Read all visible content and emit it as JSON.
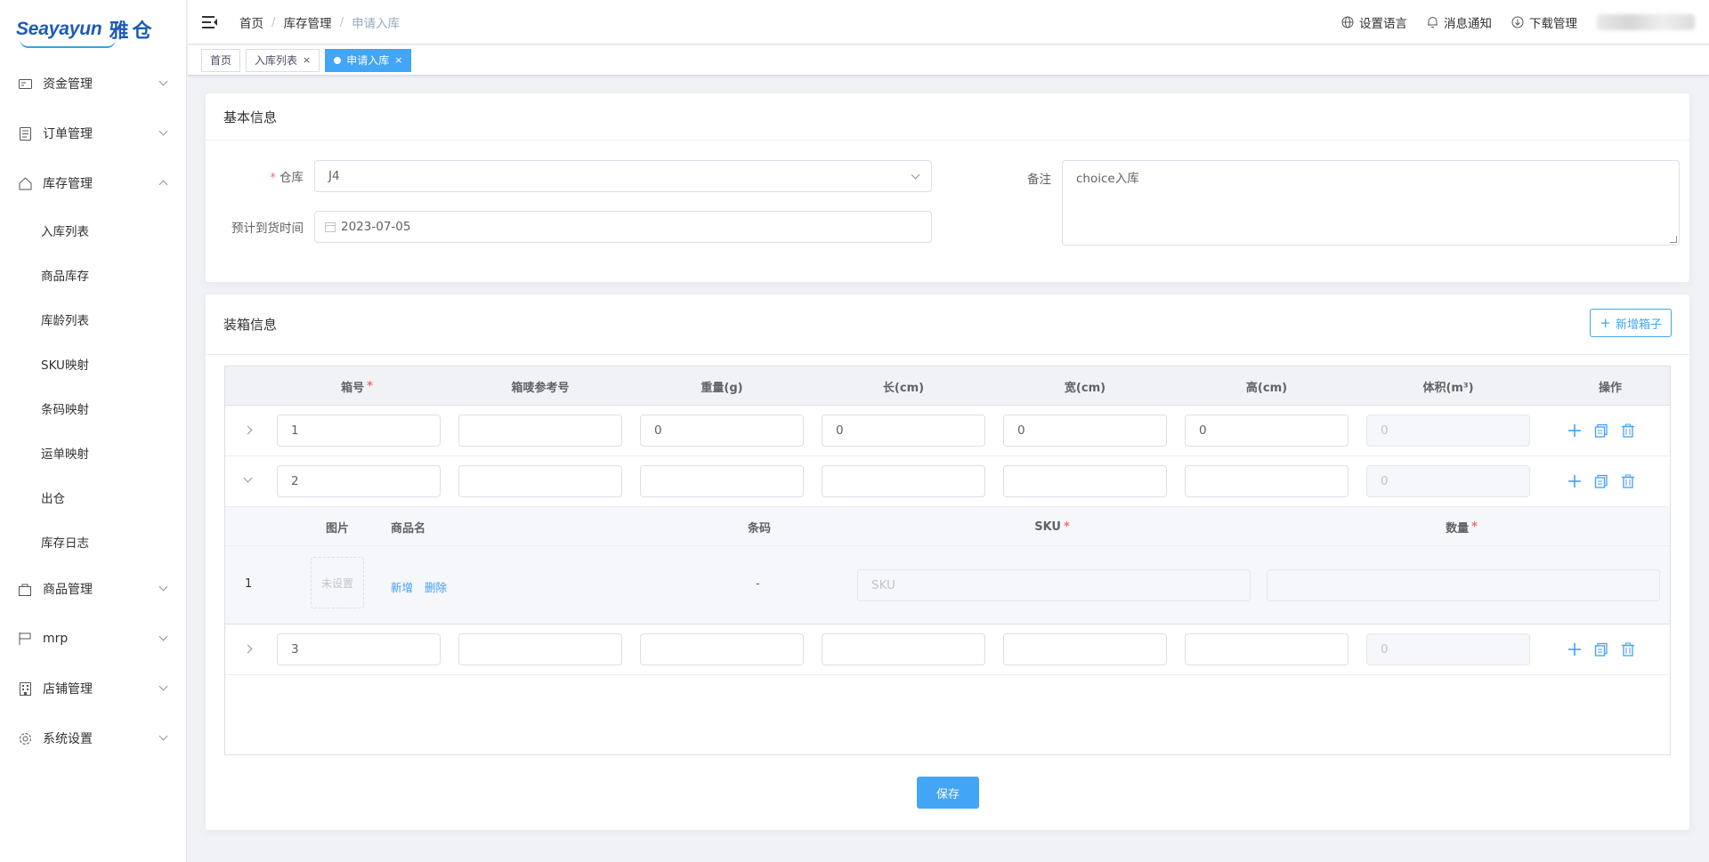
{
  "logo": {
    "brand": "Seayayun",
    "brand_cn": "雅仓"
  },
  "sidebar": {
    "items": [
      {
        "label": "资金管理",
        "icon": "wallet-icon"
      },
      {
        "label": "订单管理",
        "icon": "order-icon"
      },
      {
        "label": "库存管理",
        "icon": "home-icon",
        "expanded": true
      },
      {
        "label": "商品管理",
        "icon": "bag-icon"
      },
      {
        "label": "mrp",
        "icon": "flag-icon"
      },
      {
        "label": "店铺管理",
        "icon": "building-icon"
      },
      {
        "label": "系统设置",
        "icon": "gear-icon"
      }
    ],
    "sub_items": [
      "入库列表",
      "商品库存",
      "库龄列表",
      "SKU映射",
      "条码映射",
      "运单映射",
      "出仓",
      "库存日志"
    ]
  },
  "header": {
    "breadcrumb": [
      "首页",
      "库存管理",
      "申请入库"
    ],
    "language": "设置语言",
    "notify": "消息通知",
    "download": "下载管理"
  },
  "tags": [
    {
      "label": "首页"
    },
    {
      "label": "入库列表",
      "close": "×"
    },
    {
      "label": "申请入库",
      "close": "×",
      "active": true
    }
  ],
  "basic": {
    "title": "基本信息",
    "warehouse_label": "仓库",
    "warehouse_value": "J4",
    "arrival_label": "预计到货时间",
    "arrival_value": "2023-07-05",
    "remark_label": "备注",
    "remark_value": "choice入库"
  },
  "boxing": {
    "title": "装箱信息",
    "add_button": "新增箱子",
    "columns": [
      "箱号",
      "箱唛参考号",
      "重量(g)",
      "长(cm)",
      "宽(cm)",
      "高(cm)",
      "体积(m³)",
      "操作"
    ],
    "rows": [
      {
        "no": "1",
        "ref": "",
        "weight": "0",
        "length": "0",
        "width": "0",
        "height": "0",
        "volume": "0"
      },
      {
        "no": "2",
        "ref": "",
        "weight": "",
        "length": "",
        "width": "",
        "height": "",
        "volume": "0"
      },
      {
        "no": "3",
        "ref": "",
        "weight": "",
        "length": "",
        "width": "",
        "height": "",
        "volume": "0"
      }
    ],
    "sub_columns": [
      "图片",
      "商品名",
      "条码",
      "SKU",
      "数量"
    ],
    "sub_row": {
      "index": "1",
      "image_placeholder": "未设置",
      "add_link": "新增",
      "delete_link": "删除",
      "barcode": "-",
      "sku_placeholder": "SKU"
    },
    "save": "保存"
  },
  "colors": {
    "accent": "#42a5f5",
    "link": "#409eff",
    "brand": "#1d5bb5",
    "required": "#f56c6c"
  }
}
